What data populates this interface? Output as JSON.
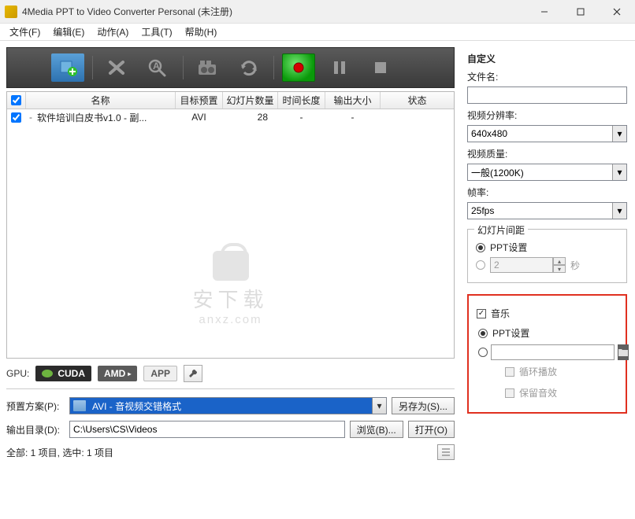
{
  "titlebar": {
    "title": "4Media PPT to Video Converter Personal (未注册)"
  },
  "menu": {
    "file": "文件(F)",
    "edit": "编辑(E)",
    "action": "动作(A)",
    "tools": "工具(T)",
    "help": "帮助(H)"
  },
  "columns": {
    "name": "名称",
    "preset": "目标预置",
    "slides": "幻灯片数量",
    "duration": "时间长度",
    "size": "输出大小",
    "status": "状态"
  },
  "rows": [
    {
      "checked": true,
      "name": "软件培训白皮书v1.0 - 副...",
      "preset": "AVI",
      "slides": "28",
      "duration": "-",
      "size": "-",
      "status": ""
    }
  ],
  "watermark": {
    "line1": "安下载",
    "line2": "anxz.com"
  },
  "gpu": {
    "label": "GPU:",
    "cuda": "CUDA",
    "amd": "AMD",
    "app": "APP"
  },
  "bottom": {
    "preset_label": "预置方案(P):",
    "preset_value": "AVI - 音视频交错格式",
    "saveas": "另存为(S)...",
    "output_label": "输出目录(D):",
    "output_value": "C:\\Users\\CS\\Videos",
    "browse": "浏览(B)...",
    "open": "打开(O)",
    "status": "全部: 1 项目, 选中: 1 项目"
  },
  "right": {
    "custom": "自定义",
    "filename_label": "文件名:",
    "filename_value": "",
    "resolution_label": "视频分辨率:",
    "resolution_value": "640x480",
    "quality_label": "视频质量:",
    "quality_value": "一般(1200K)",
    "fps_label": "帧率:",
    "fps_value": "25fps",
    "interval_title": "幻灯片间距",
    "interval_ppt": "PPT设置",
    "interval_custom_value": "2",
    "interval_unit": "秒",
    "music_label": "音乐",
    "music_ppt": "PPT设置",
    "loop_play": "循环播放",
    "keep_effect": "保留音效"
  }
}
